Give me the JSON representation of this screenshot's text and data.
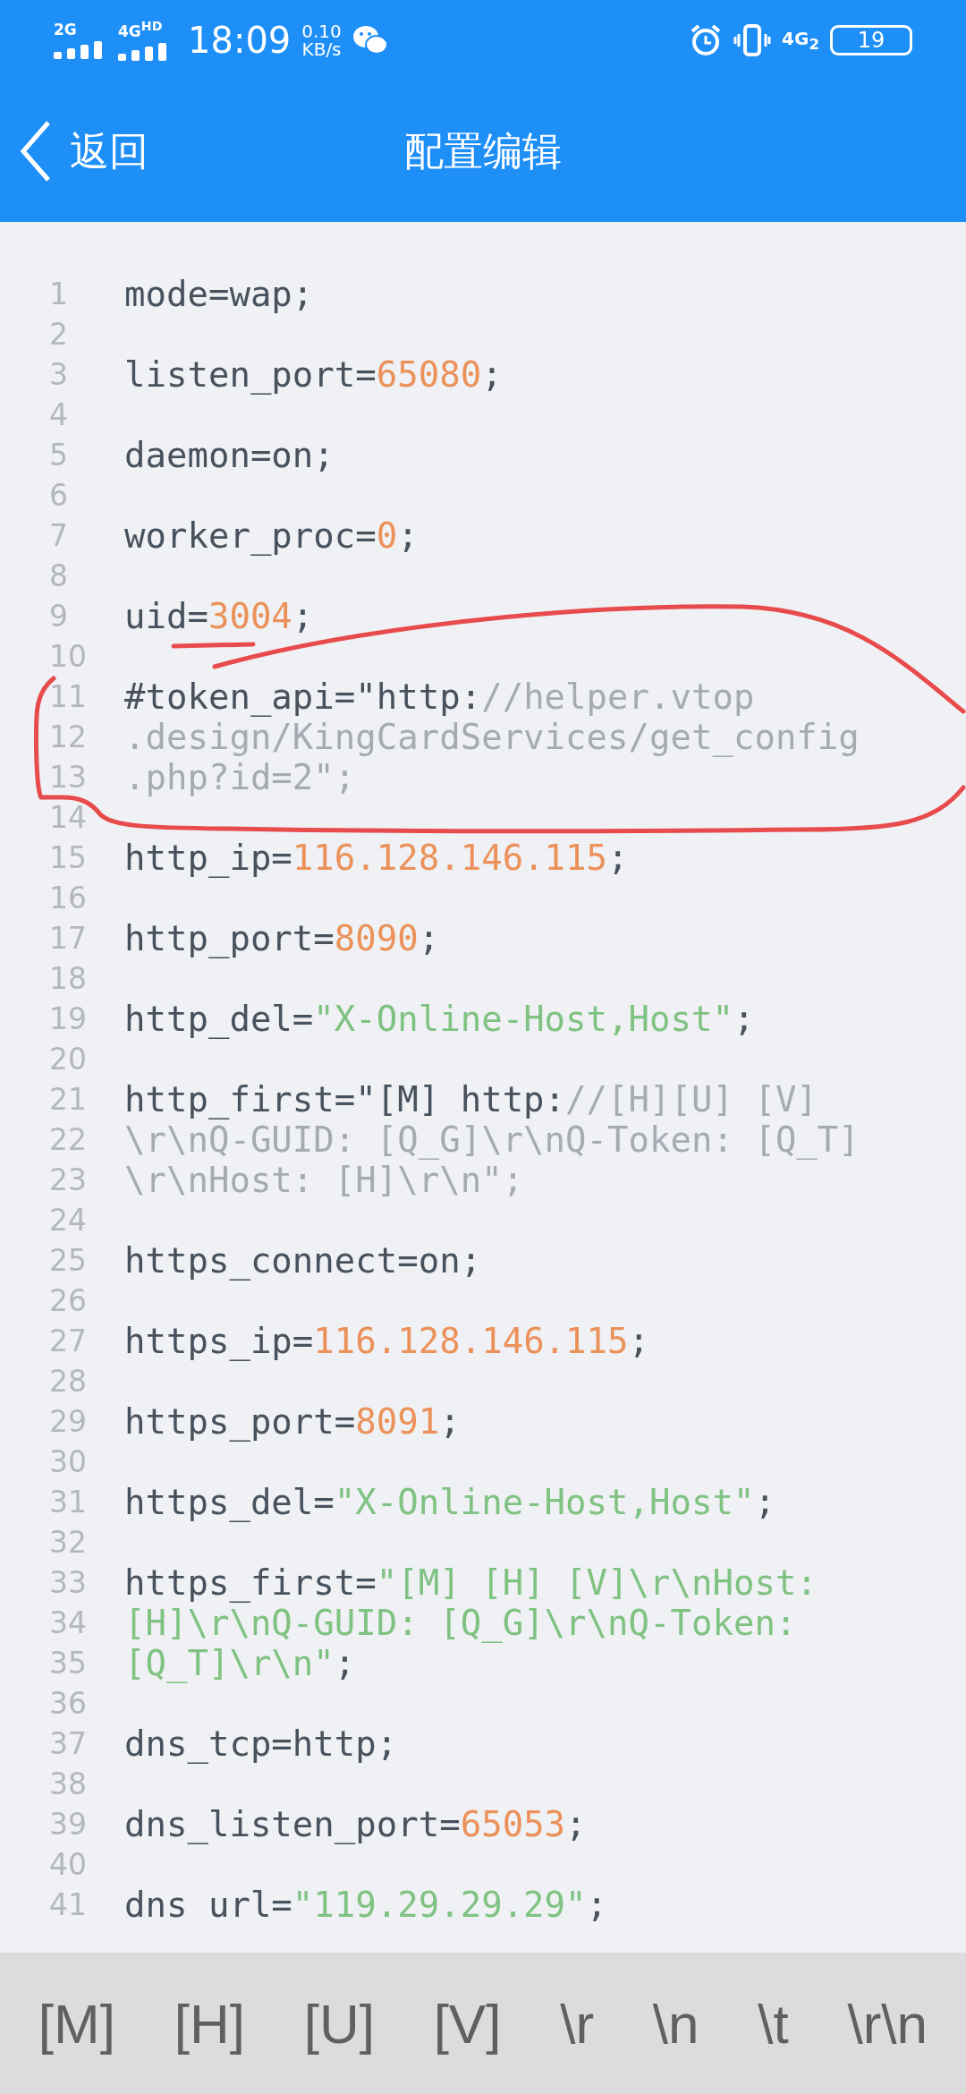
{
  "status_bar": {
    "signals": [
      {
        "label": "2G"
      },
      {
        "label": "4G",
        "suffix": "HD"
      }
    ],
    "time": "18:09",
    "speed": "0.10",
    "speed_unit": "KB/s",
    "network": "4G",
    "sim": "2",
    "battery": "19"
  },
  "header": {
    "back": "返回",
    "title": "配置编辑"
  },
  "lines": [
    {
      "number": "1",
      "segments": [
        {
          "kind": "plain",
          "text": "mode=wap;"
        }
      ]
    },
    {
      "number": "2"
    },
    {
      "number": "3",
      "segments": [
        {
          "kind": "plain",
          "text": "listen_port="
        },
        {
          "kind": "number",
          "text": "65080"
        },
        {
          "kind": "plain",
          "text": ";"
        }
      ]
    },
    {
      "number": "4"
    },
    {
      "number": "5",
      "segments": [
        {
          "kind": "plain",
          "text": "daemon=on;"
        }
      ]
    },
    {
      "number": "6"
    },
    {
      "number": "7",
      "segments": [
        {
          "kind": "plain",
          "text": "worker_proc="
        },
        {
          "kind": "number",
          "text": "0"
        },
        {
          "kind": "plain",
          "text": ";"
        }
      ]
    },
    {
      "number": "8"
    },
    {
      "number": "9",
      "segments": [
        {
          "kind": "plain",
          "text": "uid="
        },
        {
          "kind": "number",
          "text": "3004"
        },
        {
          "kind": "plain",
          "text": ";"
        }
      ]
    },
    {
      "number": "10"
    },
    {
      "number": "11",
      "segments": [
        {
          "kind": "plain",
          "text": "#token_api=\"http:"
        },
        {
          "kind": "comment",
          "text": "//helper.vtop"
        }
      ]
    },
    {
      "number": "12",
      "segments": [
        {
          "kind": "comment",
          "text": ".design/KingCardServices/get_config"
        }
      ]
    },
    {
      "number": "13",
      "segments": [
        {
          "kind": "comment",
          "text": ".php?id=2\";"
        }
      ]
    },
    {
      "number": "14"
    },
    {
      "number": "15",
      "segments": [
        {
          "kind": "plain",
          "text": "http_ip="
        },
        {
          "kind": "number",
          "text": "116.128.146.115"
        },
        {
          "kind": "plain",
          "text": ";"
        }
      ]
    },
    {
      "number": "16"
    },
    {
      "number": "17",
      "segments": [
        {
          "kind": "plain",
          "text": "http_port="
        },
        {
          "kind": "number",
          "text": "8090"
        },
        {
          "kind": "plain",
          "text": ";"
        }
      ]
    },
    {
      "number": "18"
    },
    {
      "number": "19",
      "segments": [
        {
          "kind": "plain",
          "text": "http_del="
        },
        {
          "kind": "string",
          "text": "\"X-Online-Host,Host\""
        },
        {
          "kind": "plain",
          "text": ";"
        }
      ]
    },
    {
      "number": "20"
    },
    {
      "number": "21",
      "segments": [
        {
          "kind": "plain",
          "text": "http_first=\"[M] http:"
        },
        {
          "kind": "comment",
          "text": "//[H][U] [V]"
        }
      ]
    },
    {
      "number": "22",
      "segments": [
        {
          "kind": "comment",
          "text": "\\r\\nQ-GUID: [Q_G]\\r\\nQ-Token: [Q_T]"
        }
      ]
    },
    {
      "number": "23",
      "segments": [
        {
          "kind": "comment",
          "text": "\\r\\nHost: [H]\\r\\n\";"
        }
      ]
    },
    {
      "number": "24"
    },
    {
      "number": "25",
      "segments": [
        {
          "kind": "plain",
          "text": "https_connect=on;"
        }
      ]
    },
    {
      "number": "26"
    },
    {
      "number": "27",
      "segments": [
        {
          "kind": "plain",
          "text": "https_ip="
        },
        {
          "kind": "number",
          "text": "116.128.146.115"
        },
        {
          "kind": "plain",
          "text": ";"
        }
      ]
    },
    {
      "number": "28"
    },
    {
      "number": "29",
      "segments": [
        {
          "kind": "plain",
          "text": "https_port="
        },
        {
          "kind": "number",
          "text": "8091"
        },
        {
          "kind": "plain",
          "text": ";"
        }
      ]
    },
    {
      "number": "30"
    },
    {
      "number": "31",
      "segments": [
        {
          "kind": "plain",
          "text": "https_del="
        },
        {
          "kind": "string",
          "text": "\"X-Online-Host,Host\""
        },
        {
          "kind": "plain",
          "text": ";"
        }
      ]
    },
    {
      "number": "32"
    },
    {
      "number": "33",
      "segments": [
        {
          "kind": "plain",
          "text": "https_first="
        },
        {
          "kind": "string",
          "text": "\"[M] [H] [V]\\r\\nHost:"
        }
      ]
    },
    {
      "number": "34",
      "segments": [
        {
          "kind": "string",
          "text": "[H]\\r\\nQ-GUID: [Q_G]\\r\\nQ-Token:"
        }
      ]
    },
    {
      "number": "35",
      "segments": [
        {
          "kind": "string",
          "text": "[Q_T]\\r\\n\""
        },
        {
          "kind": "plain",
          "text": ";"
        }
      ]
    },
    {
      "number": "36"
    },
    {
      "number": "37",
      "segments": [
        {
          "kind": "plain",
          "text": "dns_tcp=http;"
        }
      ]
    },
    {
      "number": "38"
    },
    {
      "number": "39",
      "segments": [
        {
          "kind": "plain",
          "text": "dns_listen_port="
        },
        {
          "kind": "number",
          "text": "65053"
        },
        {
          "kind": "plain",
          "text": ";"
        }
      ]
    },
    {
      "number": "40"
    },
    {
      "number": "41",
      "segments": [
        {
          "kind": "plain",
          "text": "dns url="
        },
        {
          "kind": "string",
          "text": "\"119.29.29.29\""
        },
        {
          "kind": "plain",
          "text": ";"
        }
      ]
    }
  ],
  "keys": [
    "[M]",
    "[H]",
    "[U]",
    "[V]",
    "\\r",
    "\\n",
    "\\t",
    "\\r\\n"
  ]
}
